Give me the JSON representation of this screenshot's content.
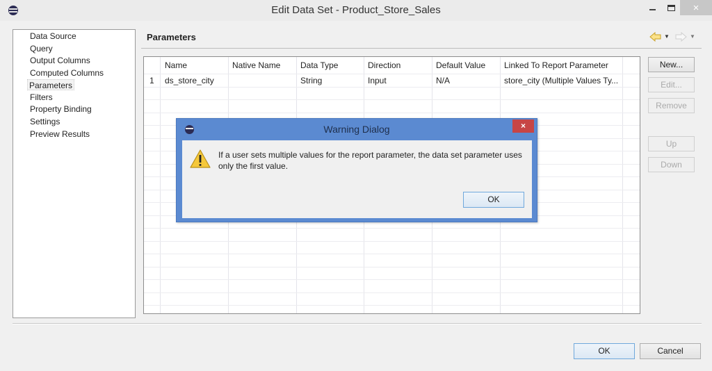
{
  "window": {
    "title": "Edit Data Set - Product_Store_Sales",
    "controls": {
      "minimize": "minimize",
      "maximize": "maximize",
      "close": "×"
    }
  },
  "nav": {
    "items": [
      {
        "label": "Data Source",
        "selected": false
      },
      {
        "label": "Query",
        "selected": false
      },
      {
        "label": "Output Columns",
        "selected": false
      },
      {
        "label": "Computed Columns",
        "selected": false
      },
      {
        "label": "Parameters",
        "selected": true
      },
      {
        "label": "Filters",
        "selected": false
      },
      {
        "label": "Property Binding",
        "selected": false
      },
      {
        "label": "Settings",
        "selected": false
      },
      {
        "label": "Preview Results",
        "selected": false
      }
    ]
  },
  "page": {
    "title": "Parameters",
    "history": {
      "back_icon": "arrow-left-icon",
      "forward_icon": "arrow-right-icon"
    }
  },
  "table": {
    "columns": [
      "",
      "Name",
      "Native Name",
      "Data Type",
      "Direction",
      "Default Value",
      "Linked To Report Parameter"
    ],
    "rows": [
      [
        "1",
        "ds_store_city",
        "",
        "String",
        "Input",
        "N/A",
        "store_city (Multiple Values Ty..."
      ]
    ]
  },
  "side_buttons": [
    {
      "label": "New...",
      "enabled": true
    },
    {
      "label": "Edit...",
      "enabled": false
    },
    {
      "label": "Remove",
      "enabled": false
    },
    {
      "label": "Up",
      "enabled": false
    },
    {
      "label": "Down",
      "enabled": false
    }
  ],
  "footer": {
    "ok": "OK",
    "cancel": "Cancel"
  },
  "warning_dialog": {
    "title": "Warning Dialog",
    "close": "×",
    "message": "If a user sets multiple values for the report parameter, the data set parameter uses only the first value.",
    "ok": "OK",
    "icon": "warning-icon"
  },
  "colors": {
    "dialog_frame": "#5b8ad1",
    "close_red": "#c74545",
    "default_button_border": "#6fa8dc"
  }
}
